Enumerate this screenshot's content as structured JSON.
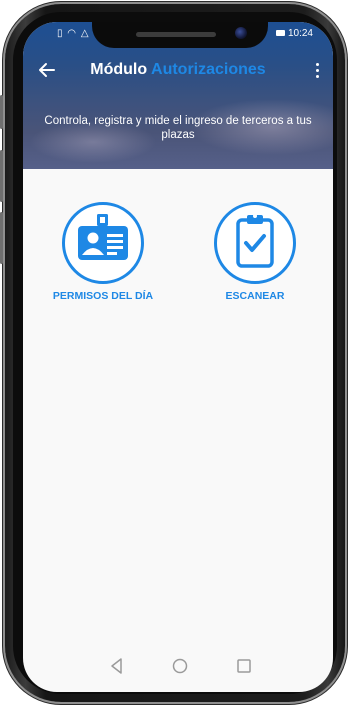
{
  "status_bar": {
    "left_icons": [
      "sim-icon",
      "wifi-icon",
      "alert-icon"
    ],
    "time": "10:24"
  },
  "app_bar": {
    "title_part1": "Módulo",
    "title_part2": "Autorizaciones",
    "subtitle": "Controla, registra y mide el ingreso de terceros a tus plazas"
  },
  "menu": {
    "items": [
      {
        "label": "PERMISOS DEL DÍA",
        "icon": "id-card-icon"
      },
      {
        "label": "ESCANEAR",
        "icon": "clipboard-check-icon"
      }
    ]
  },
  "nav_bar": {
    "buttons": [
      "back-triangle-icon",
      "home-circle-icon",
      "recents-square-icon"
    ]
  },
  "colors": {
    "accent": "#1e88e5",
    "header_top": "#1d4f93",
    "header_bottom": "#566089",
    "background": "#f9f9f9"
  }
}
